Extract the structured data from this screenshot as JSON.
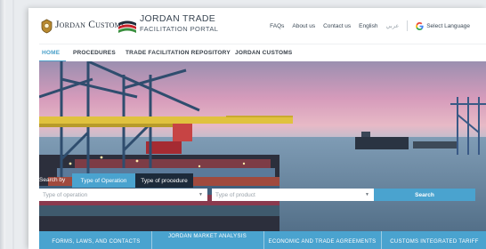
{
  "header": {
    "brand_left": "Jordan Customs",
    "brand_title": "JORDAN TRADE",
    "brand_subtitle": "FACILITATION PORTAL",
    "links": {
      "faqs": "FAQs",
      "about": "About us",
      "contact": "Contact us",
      "english": "English",
      "arabic": "عربي",
      "translate": "Select Language"
    }
  },
  "nav": {
    "items": [
      "HOME",
      "PROCEDURES",
      "TRADE FACILITATION REPOSITORY",
      "JORDAN CUSTOMS"
    ]
  },
  "search": {
    "label": "Search by",
    "tabs": [
      "Type of Operation",
      "Type of procedure"
    ],
    "field1_placeholder": "Type of operation",
    "field2_placeholder": "Type of product",
    "button": "Search"
  },
  "bottom_tabs": [
    "FORMS, LAWS, AND CONTACTS",
    "JORDAN MARKET ANALYSIS",
    "ECONOMIC AND TRADE AGREEMENTS",
    "CUSTOMS INTEGRATED TARIFF"
  ],
  "colors": {
    "accent": "#4aa3cf",
    "dark": "#1c2a3a"
  }
}
